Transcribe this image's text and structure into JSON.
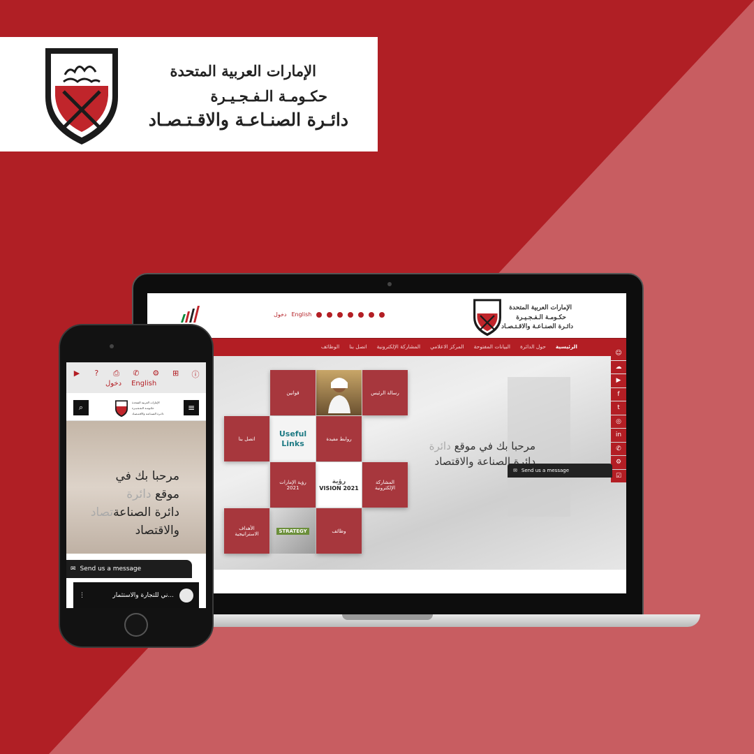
{
  "banner": {
    "line1": "الإمارات العربية المتحدة",
    "line2": "حكـومـة الـفـجـيـرة",
    "line3": "دائـرة الصنـاعـة والاقـتـصـاد",
    "shield_text": "حكومة الفجيرة"
  },
  "colors": {
    "brand_red": "#b31e24",
    "bg_dark": "#b01f25",
    "bg_light": "#c85d61"
  },
  "laptop": {
    "header": {
      "title_line1": "الإمارات العربية المتحدة",
      "title_line2": "حكـومـة الـفـجـيـرة",
      "title_line3": "دائـرة الصنـاعـة والاقـتـصـاد",
      "english_link": "English",
      "login_link": "دخول"
    },
    "nav": [
      "الرئيسية",
      "حول الدائرة",
      "البيانات المفتوحة",
      "المركز الاعلامي",
      "المشاركة الإلكترونية",
      "اتصل بنا",
      "الوظائف"
    ],
    "welcome": {
      "line1": "مرحبا بك في موقع",
      "line1_faint": "دائرة",
      "line2": "دائرة الصناعة والاقتصاد"
    },
    "tiles": {
      "chairman": "رسالة الرئيس",
      "laws": "قوانين",
      "useful_links": "روابط مفيدة",
      "useful_img_1": "Useful",
      "useful_img_2": "Links",
      "contact": "اتصل بنا",
      "eparticipation": "المشاركة الإلكترونية",
      "vision_img": "VISION 2021",
      "vision_img_ar": "رؤية",
      "vision": "رؤية الإمارات 2021",
      "jobs": "وظائف",
      "strategy_img": "STRATEGY",
      "goals": "الأهداف الاستراتيجية"
    },
    "send_message": "Send us a message"
  },
  "phone": {
    "english_link": "English",
    "login_link": "دخول",
    "welcome": {
      "line1": "مرحبا بك في",
      "line2a": "موقع",
      "line2b_faint": "دائرة",
      "line3": "دائرة الصناعة",
      "line3_faint": "تصاد",
      "line4": "والاقتصاد"
    },
    "send_message": "Send us a message",
    "video_title": "...ني للتجارة والاستثمار"
  }
}
